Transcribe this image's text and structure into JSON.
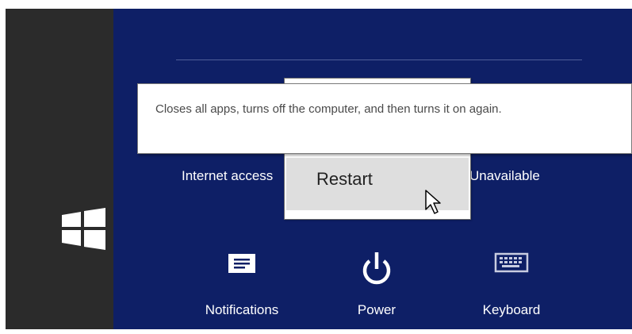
{
  "tooltip": {
    "text": "Closes all apps, turns off the computer, and then turns it on again."
  },
  "status": {
    "internet_label": "Internet access",
    "unavailable_label": "Unavailable"
  },
  "power_menu": {
    "restart_label": "Restart"
  },
  "tiles": [
    {
      "label": "Notifications",
      "icon": "notifications-icon"
    },
    {
      "label": "Power",
      "icon": "power-icon"
    },
    {
      "label": "Keyboard",
      "icon": "keyboard-icon"
    }
  ],
  "colors": {
    "pane_background": "#0e1f66",
    "charms_background": "#2b2b2b",
    "hover_gray": "#dedede"
  }
}
